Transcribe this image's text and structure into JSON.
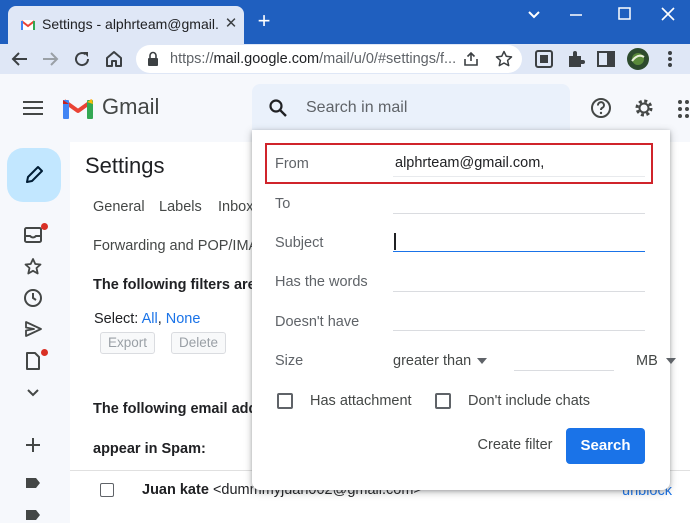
{
  "browser": {
    "tab_title": "Settings - alphrteam@gmail.com",
    "close_glyph": "✕",
    "new_tab_glyph": "+",
    "url_scheme": "https://",
    "url_host": "mail.google.com",
    "url_path": "/mail/u/0/#settings/f..."
  },
  "gmail": {
    "brand": "Gmail",
    "search_placeholder": "Search in mail"
  },
  "settings": {
    "title": "Settings",
    "tabs": [
      "General",
      "Labels",
      "Inbox"
    ],
    "tab_forwarding": "Forwarding and POP/IMA",
    "filters_heading": "The following filters are",
    "select_label": "Select:",
    "select_all": "All",
    "select_sep": ",",
    "select_none": "None",
    "export_label": "Export",
    "delete_label": "Delete",
    "blocked_heading_1": "The following email add",
    "blocked_heading_2": "appear in Spam:",
    "blocked_row": {
      "name": "Juan kate",
      "email": "<dummmyjuan002@gmail.com>",
      "action": "unblock"
    }
  },
  "search_options": {
    "from_label": "From",
    "from_value": "alphrteam@gmail.com,",
    "to_label": "To",
    "subject_label": "Subject",
    "has_words_label": "Has the words",
    "doesnt_have_label": "Doesn't have",
    "size_label": "Size",
    "size_operator": "greater than",
    "size_unit": "MB",
    "has_attachment_label": "Has attachment",
    "no_chats_label": "Don't include chats",
    "create_filter_label": "Create filter",
    "search_button_label": "Search"
  },
  "colors": {
    "chrome_frame": "#1f5fbf",
    "highlight_red": "#d0242b",
    "primary_blue": "#1a73e8"
  }
}
